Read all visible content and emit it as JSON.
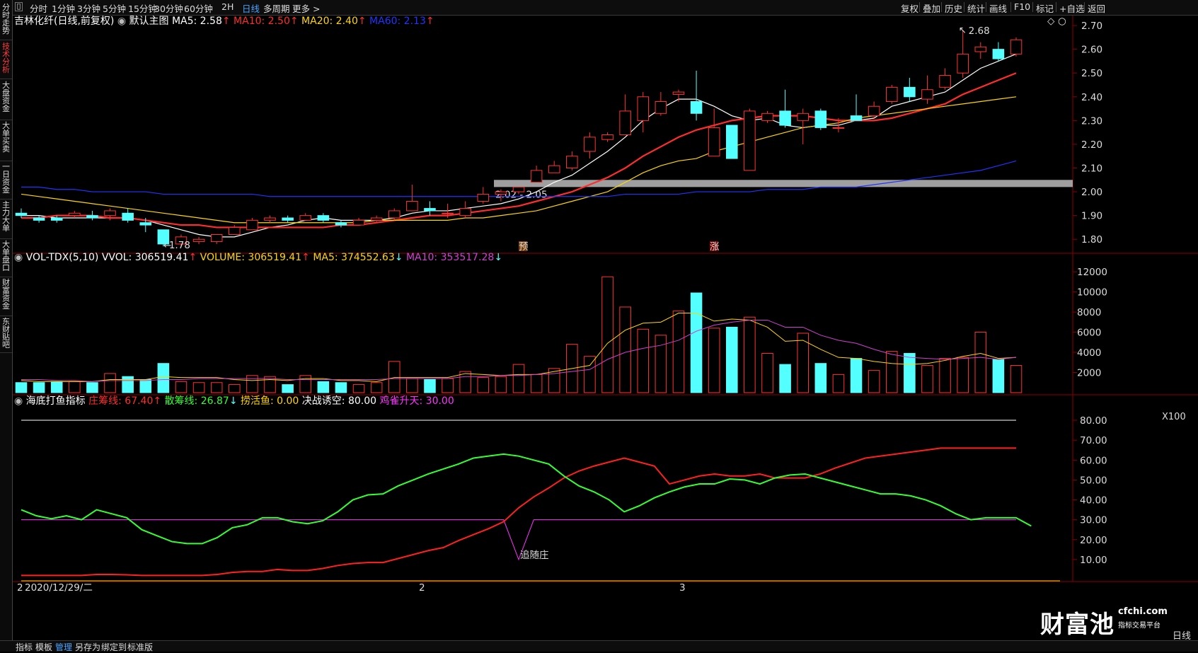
{
  "sidebar": {
    "tabs": [
      {
        "label": "分时走势",
        "active": false
      },
      {
        "label": "技术分析",
        "active": true
      },
      {
        "label": "大盘资金",
        "active": false
      },
      {
        "label": "大单买卖",
        "active": false
      },
      {
        "label": "一日资金",
        "active": false
      },
      {
        "label": "主力大单",
        "active": false
      },
      {
        "label": "大单盘口",
        "active": false
      },
      {
        "label": "财富资金",
        "active": false
      },
      {
        "label": "东财贴吧",
        "active": false
      }
    ]
  },
  "toolbar": {
    "periods": [
      "分时",
      "1分钟",
      "3分钟",
      "5分钟",
      "15分钟",
      "30分钟",
      "60分钟",
      "2H",
      "日线",
      "多周期",
      "更多 >"
    ],
    "selected_period": "日线",
    "right": [
      "复权",
      "叠加",
      "历史",
      "统计",
      "画线",
      "F10",
      "标记",
      "+自选",
      "返回"
    ]
  },
  "main_panel": {
    "title": "吉林化纤(日线,前复权)",
    "template": "默认主图",
    "ma": [
      {
        "label": "MA5: 2.58",
        "arrow": "↑",
        "color": "#ffffff"
      },
      {
        "label": "MA10: 2.50",
        "arrow": "↑",
        "color": "#ff2d2d"
      },
      {
        "label": "MA20: 2.40",
        "arrow": "↑",
        "color": "#ffd700"
      },
      {
        "label": "MA60: 2.13",
        "arrow": "↑",
        "color": "#2233ff"
      }
    ],
    "y_ticks": [
      "2.70",
      "2.60",
      "2.50",
      "2.40",
      "2.30",
      "2.20",
      "2.10",
      "2.00",
      "1.90",
      "1.80"
    ],
    "high_label": "2.68",
    "low_label": "1.78",
    "zone_label": "2.02 - 2.05",
    "marker_a": "预",
    "marker_b": "涨"
  },
  "volume_panel": {
    "title": "VOL-TDX(5,10)",
    "items": [
      {
        "label": "VVOL: 306519.41",
        "arrow": "↑",
        "color": "#ffffff"
      },
      {
        "label": "VOLUME: 306519.41",
        "arrow": "↑",
        "color": "#ffd700"
      },
      {
        "label": "MA5: 374552.63",
        "arrow": "↓",
        "color": "#ffd700"
      },
      {
        "label": "MA10: 353517.28",
        "arrow": "↓",
        "color": "#d040d0"
      }
    ],
    "y_ticks": [
      "12000",
      "10000",
      "8000",
      "6000",
      "4000",
      "2000"
    ],
    "unit": "X100"
  },
  "indicator_panel": {
    "title": "海底打鱼指标",
    "items": [
      {
        "label": "庄筹线: 67.40",
        "arrow": "↑",
        "color": "#ff2d2d"
      },
      {
        "label": "散筹线: 26.87",
        "arrow": "↓",
        "color": "#33ff33"
      },
      {
        "label": "捞活鱼: 0.00",
        "arrow": "",
        "color": "#ffd700"
      },
      {
        "label": "决战诱空: 80.00",
        "arrow": "",
        "color": "#ffffff"
      },
      {
        "label": "鸡雀升天: 30.00",
        "arrow": "",
        "color": "#ff33ff"
      }
    ],
    "y_ticks": [
      "80.00",
      "70.00",
      "60.00",
      "50.00",
      "40.00",
      "30.00",
      "20.00",
      "10.00"
    ],
    "annotation": "追随庄"
  },
  "x_axis": {
    "start_label": "2020/12/29/二",
    "start_prefix": "2",
    "month_labels": [
      "2",
      "3"
    ]
  },
  "bottom_bar": {
    "items": [
      "指标",
      "模板",
      "管理",
      "另存为",
      "绑定到",
      "标准版"
    ],
    "selected": "管理",
    "right_label": "日线"
  },
  "watermark": {
    "brand": "财富池",
    "url": "cfchi.com",
    "sub": "指标交易平台"
  },
  "colors": {
    "up": "#ff3232",
    "down": "#54ffff",
    "bg": "#000000",
    "grid": "#8b0000"
  },
  "chart_data": {
    "type": "candlestick",
    "y_range_price": [
      1.75,
      2.73
    ],
    "candles": [
      [
        1.91,
        1.9,
        1.93,
        1.89
      ],
      [
        1.89,
        1.88,
        1.9,
        1.87
      ],
      [
        1.89,
        1.88,
        1.9,
        1.87
      ],
      [
        1.9,
        1.91,
        1.92,
        1.89
      ],
      [
        1.9,
        1.89,
        1.92,
        1.88
      ],
      [
        1.9,
        1.92,
        1.93,
        1.88
      ],
      [
        1.91,
        1.88,
        1.93,
        1.87
      ],
      [
        1.87,
        1.86,
        1.89,
        1.83
      ],
      [
        1.84,
        1.78,
        1.84,
        1.77
      ],
      [
        1.78,
        1.81,
        1.82,
        1.77
      ],
      [
        1.79,
        1.8,
        1.81,
        1.78
      ],
      [
        1.79,
        1.82,
        1.82,
        1.78
      ],
      [
        1.82,
        1.85,
        1.86,
        1.82
      ],
      [
        1.84,
        1.88,
        1.89,
        1.84
      ],
      [
        1.88,
        1.89,
        1.9,
        1.87
      ],
      [
        1.89,
        1.88,
        1.9,
        1.87
      ],
      [
        1.88,
        1.9,
        1.91,
        1.88
      ],
      [
        1.9,
        1.88,
        1.91,
        1.87
      ],
      [
        1.87,
        1.86,
        1.88,
        1.85
      ],
      [
        1.86,
        1.88,
        1.89,
        1.86
      ],
      [
        1.88,
        1.89,
        1.9,
        1.87
      ],
      [
        1.89,
        1.92,
        1.93,
        1.88
      ],
      [
        1.92,
        1.96,
        2.03,
        1.92
      ],
      [
        1.93,
        1.92,
        1.96,
        1.9
      ],
      [
        1.91,
        1.91,
        1.95,
        1.89
      ],
      [
        1.9,
        1.93,
        1.96,
        1.89
      ],
      [
        1.96,
        1.99,
        2.02,
        1.95
      ],
      [
        1.99,
        2.0,
        2.01,
        1.96
      ],
      [
        2.0,
        2.02,
        2.02,
        1.99
      ],
      [
        2.04,
        2.09,
        2.11,
        2.04
      ],
      [
        2.08,
        2.11,
        2.13,
        2.08
      ],
      [
        2.1,
        2.15,
        2.17,
        2.09
      ],
      [
        2.17,
        2.23,
        2.25,
        2.14
      ],
      [
        2.22,
        2.24,
        2.25,
        2.21
      ],
      [
        2.24,
        2.34,
        2.41,
        2.24
      ],
      [
        2.3,
        2.4,
        2.42,
        2.25
      ],
      [
        2.33,
        2.38,
        2.42,
        2.32
      ],
      [
        2.41,
        2.42,
        2.43,
        2.38
      ],
      [
        2.38,
        2.33,
        2.51,
        2.3
      ],
      [
        2.15,
        2.27,
        2.35,
        2.15
      ],
      [
        2.28,
        2.14,
        2.28,
        2.14
      ],
      [
        2.09,
        2.34,
        2.35,
        2.09
      ],
      [
        2.3,
        2.33,
        2.34,
        2.29
      ],
      [
        2.34,
        2.28,
        2.43,
        2.27
      ],
      [
        2.3,
        2.33,
        2.35,
        2.2
      ],
      [
        2.34,
        2.27,
        2.35,
        2.26
      ],
      [
        2.27,
        2.27,
        2.31,
        2.25
      ],
      [
        2.32,
        2.3,
        2.41,
        2.3
      ],
      [
        2.32,
        2.36,
        2.38,
        2.31
      ],
      [
        2.38,
        2.44,
        2.45,
        2.37
      ],
      [
        2.44,
        2.4,
        2.48,
        2.38
      ],
      [
        2.39,
        2.43,
        2.49,
        2.37
      ],
      [
        2.44,
        2.49,
        2.52,
        2.43
      ],
      [
        2.5,
        2.58,
        2.68,
        2.48
      ],
      [
        2.59,
        2.61,
        2.63,
        2.56
      ],
      [
        2.6,
        2.56,
        2.63,
        2.55
      ],
      [
        2.58,
        2.64,
        2.65,
        2.57
      ]
    ],
    "ma_series": [
      {
        "name": "MA5",
        "color": "#ffffff",
        "values": [
          1.9,
          1.9,
          1.89,
          1.89,
          1.89,
          1.89,
          1.89,
          1.88,
          1.86,
          1.84,
          1.82,
          1.81,
          1.81,
          1.83,
          1.85,
          1.86,
          1.88,
          1.89,
          1.88,
          1.88,
          1.88,
          1.89,
          1.91,
          1.92,
          1.92,
          1.93,
          1.94,
          1.95,
          1.97,
          2.0,
          2.04,
          2.07,
          2.12,
          2.17,
          2.23,
          2.3,
          2.35,
          2.39,
          2.39,
          2.36,
          2.32,
          2.3,
          2.31,
          2.28,
          2.27,
          2.28,
          2.28,
          2.3,
          2.31,
          2.36,
          2.38,
          2.4,
          2.42,
          2.47,
          2.52,
          2.55,
          2.58
        ]
      },
      {
        "name": "MA10",
        "color": "#ff2d2d",
        "values": [
          1.89,
          1.89,
          1.9,
          1.9,
          1.9,
          1.89,
          1.89,
          1.88,
          1.87,
          1.86,
          1.86,
          1.85,
          1.85,
          1.85,
          1.85,
          1.85,
          1.85,
          1.85,
          1.86,
          1.86,
          1.87,
          1.88,
          1.89,
          1.9,
          1.9,
          1.91,
          1.92,
          1.93,
          1.94,
          1.96,
          1.98,
          2.0,
          2.03,
          2.06,
          2.1,
          2.15,
          2.19,
          2.23,
          2.26,
          2.28,
          2.3,
          2.31,
          2.32,
          2.32,
          2.32,
          2.31,
          2.3,
          2.3,
          2.3,
          2.31,
          2.33,
          2.35,
          2.37,
          2.41,
          2.44,
          2.47,
          2.5
        ]
      },
      {
        "name": "MA20",
        "color": "#ffd700",
        "values": [
          1.99,
          1.98,
          1.97,
          1.96,
          1.95,
          1.94,
          1.93,
          1.92,
          1.91,
          1.9,
          1.89,
          1.88,
          1.87,
          1.87,
          1.87,
          1.87,
          1.87,
          1.87,
          1.87,
          1.87,
          1.88,
          1.88,
          1.88,
          1.88,
          1.88,
          1.89,
          1.89,
          1.9,
          1.91,
          1.92,
          1.94,
          1.96,
          1.98,
          2.0,
          2.04,
          2.08,
          2.11,
          2.13,
          2.14,
          2.17,
          2.19,
          2.21,
          2.23,
          2.25,
          2.27,
          2.28,
          2.29,
          2.31,
          2.32,
          2.33,
          2.34,
          2.35,
          2.36,
          2.37,
          2.38,
          2.39,
          2.4
        ]
      },
      {
        "name": "MA60",
        "color": "#2233ff",
        "values": [
          2.02,
          2.02,
          2.01,
          2.01,
          2.0,
          2.0,
          2.0,
          2.0,
          1.99,
          1.99,
          1.99,
          1.99,
          1.99,
          1.99,
          1.98,
          1.98,
          1.98,
          1.98,
          1.98,
          1.98,
          1.98,
          1.98,
          1.98,
          1.98,
          1.98,
          1.98,
          1.98,
          1.98,
          1.98,
          1.98,
          1.98,
          1.98,
          1.98,
          1.98,
          1.99,
          1.99,
          1.99,
          1.99,
          2.0,
          2.0,
          2.0,
          2.0,
          2.01,
          2.01,
          2.01,
          2.02,
          2.02,
          2.02,
          2.03,
          2.04,
          2.05,
          2.06,
          2.07,
          2.08,
          2.09,
          2.11,
          2.13
        ]
      }
    ],
    "volume": {
      "y_range": [
        0,
        12500
      ],
      "values": [
        1000,
        1000,
        1100,
        1100,
        1000,
        1900,
        1600,
        1300,
        2900,
        1100,
        1000,
        1000,
        800,
        1700,
        1600,
        800,
        1700,
        1100,
        1000,
        800,
        1000,
        3100,
        1400,
        1300,
        1400,
        2100,
        1500,
        1600,
        2800,
        1800,
        2400,
        4800,
        3600,
        11500,
        8500,
        6300,
        5700,
        8100,
        9900,
        6400,
        6500,
        7500,
        3900,
        2800,
        5900,
        2900,
        1800,
        3400,
        2200,
        4100,
        3900,
        2700,
        3400,
        3500,
        6000,
        3300,
        2700,
        3000
      ],
      "ma5": [
        1200,
        1100,
        1100,
        1100,
        1100,
        1300,
        1300,
        1300,
        1600,
        1500,
        1500,
        1500,
        1300,
        1200,
        1300,
        1200,
        1400,
        1400,
        1200,
        1200,
        1100,
        1500,
        1500,
        1500,
        1500,
        1900,
        1800,
        1700,
        1800,
        1800,
        2100,
        2400,
        2700,
        4900,
        6200,
        6900,
        7000,
        7900,
        7900,
        7100,
        7300,
        7200,
        6500,
        5100,
        5200,
        4300,
        3500,
        3400,
        3100,
        2900,
        2800,
        2900,
        3200,
        3600,
        3900,
        3400,
        3500
      ],
      "ma10": [
        1300,
        1300,
        1200,
        1200,
        1100,
        1200,
        1200,
        1200,
        1300,
        1300,
        1400,
        1400,
        1400,
        1400,
        1400,
        1300,
        1300,
        1300,
        1300,
        1300,
        1300,
        1400,
        1400,
        1400,
        1400,
        1600,
        1600,
        1700,
        1700,
        1800,
        1900,
        2100,
        2300,
        3300,
        4000,
        4400,
        4700,
        5200,
        6100,
        6700,
        7000,
        7200,
        7200,
        6500,
        6500,
        5700,
        5200,
        4900,
        4300,
        3800,
        3500,
        3400,
        3300,
        3400,
        3500,
        3300,
        3500
      ]
    },
    "indicator": {
      "y_range": [
        0,
        85
      ],
      "zhuang": [
        2,
        2,
        2,
        2,
        2,
        2.5,
        2.5,
        2.3,
        2,
        2,
        2,
        2,
        2,
        2.5,
        3.5,
        4,
        4,
        5,
        4.5,
        4.5,
        5.5,
        7,
        8,
        8.5,
        8.5,
        10.5,
        12.5,
        14.5,
        16,
        19.5,
        22.5,
        25.5,
        29,
        36,
        41.5,
        46,
        51,
        54.5,
        57,
        59,
        61,
        59,
        57,
        48,
        50,
        52,
        53,
        52,
        52,
        53,
        51,
        51,
        51,
        53,
        56,
        58.5,
        61,
        62,
        63,
        64,
        65,
        66,
        66,
        66,
        66,
        66,
        66
      ],
      "sanchou": [
        35,
        32,
        30.5,
        32,
        30,
        35,
        33,
        31,
        25,
        22,
        19,
        18,
        18,
        21,
        26,
        27.5,
        31,
        31,
        29,
        28,
        29.5,
        34,
        40,
        42.5,
        43,
        47,
        50,
        53,
        55.5,
        58,
        61,
        62,
        63,
        62,
        60,
        58,
        52,
        47,
        44,
        40,
        34,
        37,
        41,
        44,
        46.5,
        48,
        48,
        50.5,
        50,
        48,
        51,
        52.5,
        53,
        51,
        49,
        47,
        45,
        43,
        43,
        42,
        40,
        37,
        33,
        30,
        31,
        31,
        31,
        26.87
      ],
      "juezhan": 80,
      "jique": 30,
      "jique_dip_index": 33,
      "jique_dip_value": 10
    }
  }
}
